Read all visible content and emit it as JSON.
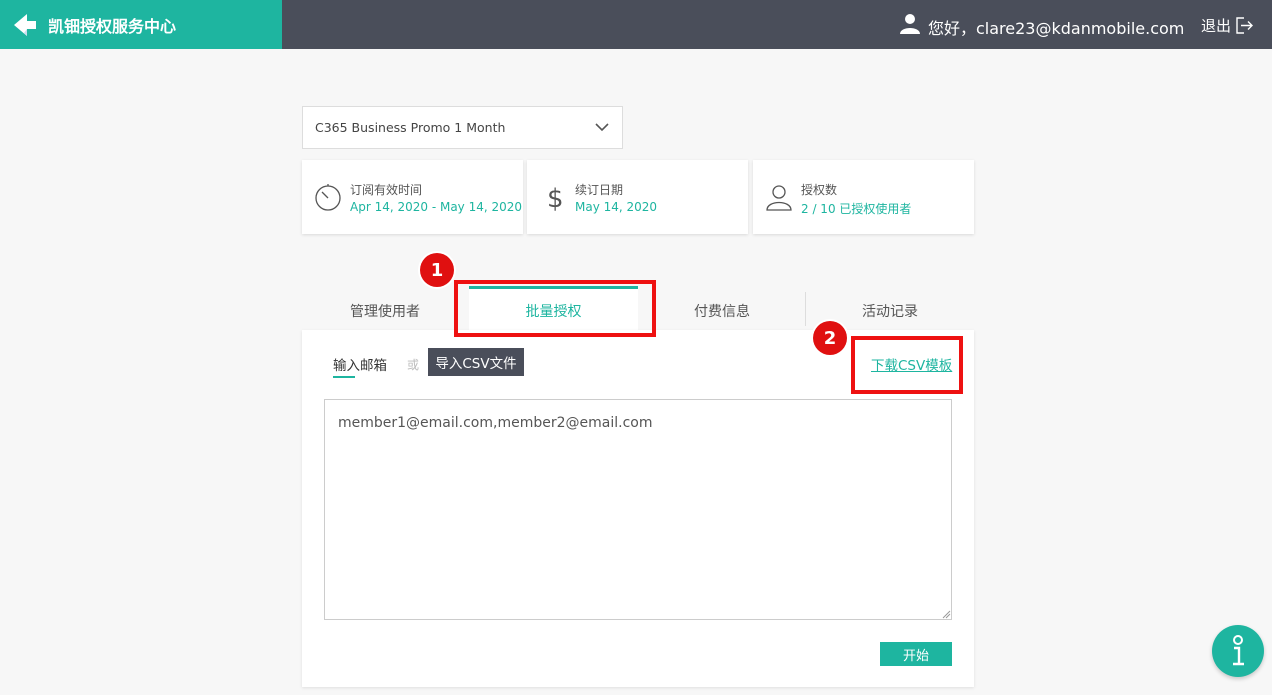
{
  "header": {
    "brand_title": "凯钿授权服务中心",
    "greeting": "您好，clare23@kdanmobile.com",
    "logout_label": "退出"
  },
  "product_select": {
    "selected": "C365 Business Promo 1 Month"
  },
  "cards": [
    {
      "icon": "timer-icon",
      "label": "订阅有效时间",
      "value": "Apr 14, 2020 - May 14, 2020"
    },
    {
      "icon": "dollar-icon",
      "label": "续订日期",
      "value": "May 14, 2020"
    },
    {
      "icon": "user-icon",
      "label": "授权数",
      "value": "2 / 10 已授权使用者"
    }
  ],
  "tabs": [
    {
      "label": "管理使用者",
      "active": false
    },
    {
      "label": "批量授权",
      "active": true
    },
    {
      "label": "付费信息",
      "active": false
    },
    {
      "label": "活动记录",
      "active": false
    }
  ],
  "panel": {
    "email_tab_label": "输入邮箱",
    "or_text": "或",
    "import_csv_label": "导入CSV文件",
    "download_csv_label": "下载CSV模板",
    "emails_value": "member1@email.com,member2@email.com",
    "start_label": "开始"
  },
  "annotations": {
    "badge1": "1",
    "badge2": "2"
  },
  "colors": {
    "accent": "#1eb5a0",
    "topbar": "#4a4e5a",
    "highlight": "#ee1111"
  }
}
